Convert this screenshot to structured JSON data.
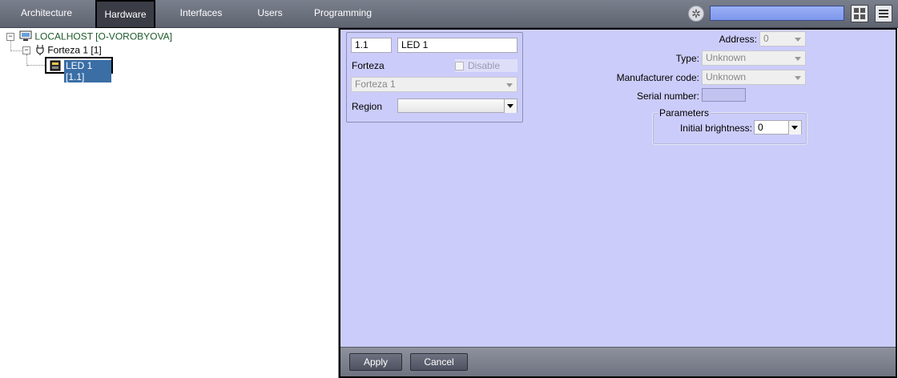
{
  "menu": {
    "tabs": [
      {
        "label": "Architecture"
      },
      {
        "label": "Hardware"
      },
      {
        "label": "Interfaces"
      },
      {
        "label": "Users"
      },
      {
        "label": "Programming"
      }
    ],
    "active_tab": "Hardware",
    "icons": [
      "settings-icon",
      "layout-grid-icon",
      "menu-lines-icon"
    ]
  },
  "tree": {
    "root": {
      "label": "LOCALHOST [O-VOROBYOVA]",
      "icon": "computer-icon"
    },
    "controller": {
      "label": "Forteza 1 [1]",
      "icon": "device-plug-icon"
    },
    "selected": {
      "label": "LED 1 [1.1]",
      "icon": "led-device-icon"
    }
  },
  "object_card": {
    "id_value": "1.1",
    "name_value": "LED 1",
    "type_label": "Forteza",
    "disable_label": "Disable",
    "parent_value": "Forteza 1",
    "region_label": "Region",
    "region_value": ""
  },
  "properties": {
    "address_label": "Address:",
    "address_value": "0",
    "type_label": "Type:",
    "type_value": "Unknown",
    "manufacturer_label": "Manufacturer code:",
    "manufacturer_value": "Unknown",
    "serial_label": "Serial number:",
    "serial_value": "",
    "parameters_title": "Parameters",
    "brightness_label": "Initial brightness:",
    "brightness_value": "0"
  },
  "footer": {
    "apply_label": "Apply",
    "cancel_label": "Cancel"
  },
  "colors": {
    "panel_background": "#ccccfa",
    "tree_label": "#1d5a2a",
    "selection": "#3a6ea5"
  }
}
